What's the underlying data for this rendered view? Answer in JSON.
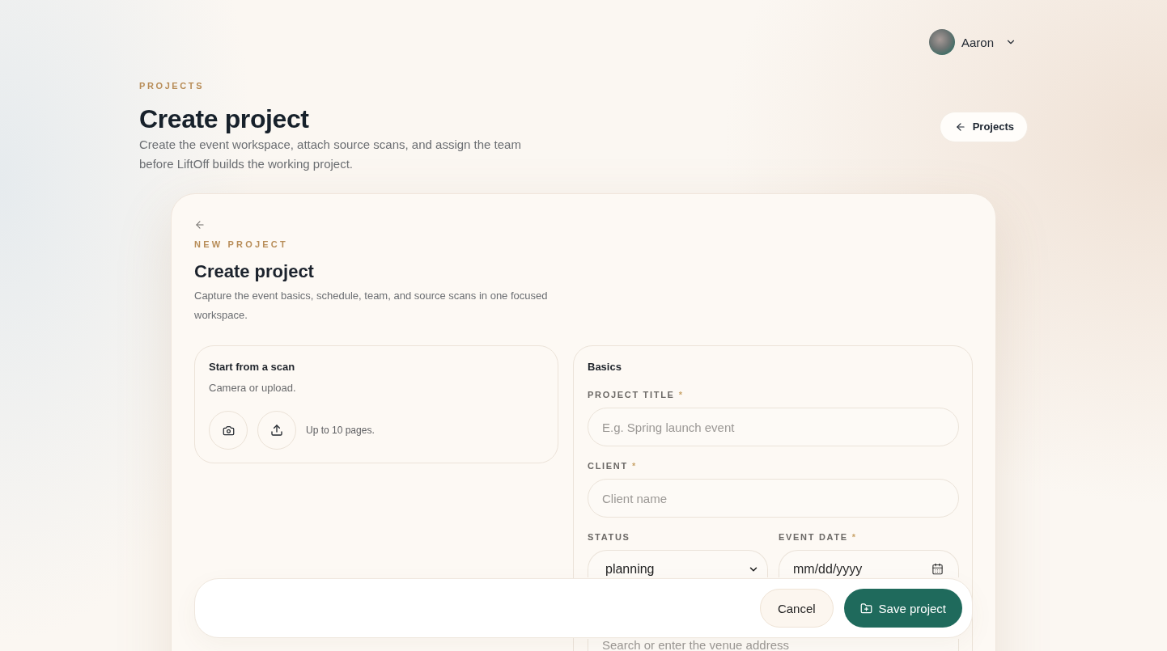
{
  "user_menu": {
    "name": "Aaron"
  },
  "header": {
    "eyebrow": "PROJECTS",
    "title": "Create project",
    "description": "Create the event workspace, attach source scans, and assign the team before LiftOff builds the working project.",
    "back_button": "Projects"
  },
  "card": {
    "eyebrow": "NEW PROJECT",
    "title": "Create project",
    "description": "Capture the event basics, schedule, team, and source scans in one focused workspace."
  },
  "scan": {
    "title": "Start from a scan",
    "subtitle": "Camera or upload.",
    "note": "Up to 10 pages."
  },
  "basics": {
    "title": "Basics",
    "project_title": {
      "label": "PROJECT TITLE",
      "required_mark": "*",
      "placeholder": "E.g. Spring launch event"
    },
    "client": {
      "label": "CLIENT",
      "required_mark": "*",
      "placeholder": "Client name"
    },
    "status": {
      "label": "STATUS",
      "value": "planning"
    },
    "event_date": {
      "label": "EVENT DATE",
      "required_mark": "*",
      "placeholder": "mm/dd/yyyy"
    },
    "venue": {
      "placeholder": "Search or enter the venue address"
    }
  },
  "actions": {
    "cancel": "Cancel",
    "save": "Save project"
  }
}
